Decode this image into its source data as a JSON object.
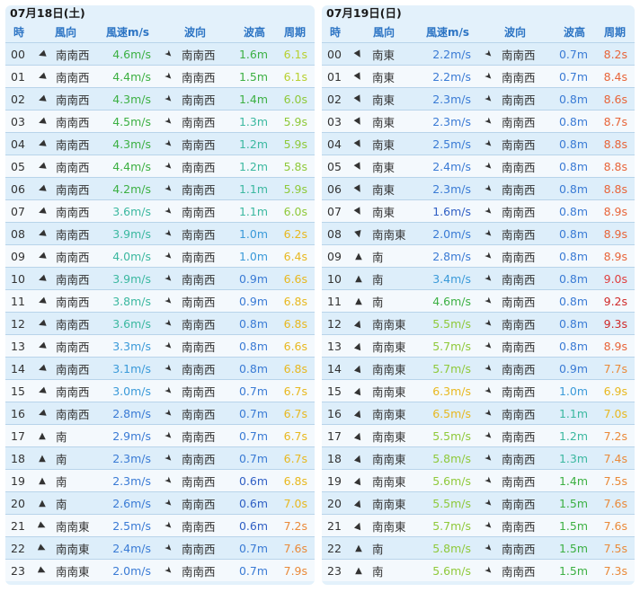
{
  "headers": {
    "hour": "時",
    "wind_dir": "風向",
    "wind_speed": "風速m/s",
    "wave_dir": "波向",
    "wave_height": "波高",
    "period": "周期"
  },
  "days": [
    {
      "date": "07月18日(土)",
      "rows": [
        {
          "h": "00",
          "d": "南南西",
          "a": 250,
          "s": "4.6m/s",
          "sc": "#3cb043",
          "wd": "南南西",
          "wh": "1.6m",
          "hc": "#3cb043",
          "p": "6.1s",
          "pc": "#b8d030"
        },
        {
          "h": "01",
          "d": "南南西",
          "a": 250,
          "s": "4.4m/s",
          "sc": "#3cb043",
          "wd": "南南西",
          "wh": "1.5m",
          "hc": "#3cb043",
          "p": "6.1s",
          "pc": "#b8d030"
        },
        {
          "h": "02",
          "d": "南南西",
          "a": 250,
          "s": "4.3m/s",
          "sc": "#3cb043",
          "wd": "南南西",
          "wh": "1.4m",
          "hc": "#3cb043",
          "p": "6.0s",
          "pc": "#8fc93a"
        },
        {
          "h": "03",
          "d": "南南西",
          "a": 250,
          "s": "4.5m/s",
          "sc": "#3cb043",
          "wd": "南南西",
          "wh": "1.3m",
          "hc": "#3bb8a0",
          "p": "5.9s",
          "pc": "#8fc93a"
        },
        {
          "h": "04",
          "d": "南南西",
          "a": 250,
          "s": "4.3m/s",
          "sc": "#3cb043",
          "wd": "南南西",
          "wh": "1.2m",
          "hc": "#3bb8a0",
          "p": "5.9s",
          "pc": "#8fc93a"
        },
        {
          "h": "05",
          "d": "南南西",
          "a": 250,
          "s": "4.4m/s",
          "sc": "#3cb043",
          "wd": "南南西",
          "wh": "1.2m",
          "hc": "#3bb8a0",
          "p": "5.8s",
          "pc": "#8fc93a"
        },
        {
          "h": "06",
          "d": "南南西",
          "a": 250,
          "s": "4.2m/s",
          "sc": "#3cb043",
          "wd": "南南西",
          "wh": "1.1m",
          "hc": "#3bb8a0",
          "p": "5.9s",
          "pc": "#8fc93a"
        },
        {
          "h": "07",
          "d": "南南西",
          "a": 250,
          "s": "3.6m/s",
          "sc": "#3bb8a0",
          "wd": "南南西",
          "wh": "1.1m",
          "hc": "#3bb8a0",
          "p": "6.0s",
          "pc": "#8fc93a"
        },
        {
          "h": "08",
          "d": "南南西",
          "a": 250,
          "s": "3.9m/s",
          "sc": "#3bb8a0",
          "wd": "南南西",
          "wh": "1.0m",
          "hc": "#3a9ad9",
          "p": "6.2s",
          "pc": "#e8b820"
        },
        {
          "h": "09",
          "d": "南南西",
          "a": 250,
          "s": "4.0m/s",
          "sc": "#3bb8a0",
          "wd": "南南西",
          "wh": "1.0m",
          "hc": "#3a9ad9",
          "p": "6.4s",
          "pc": "#e8b820"
        },
        {
          "h": "10",
          "d": "南南西",
          "a": 250,
          "s": "3.9m/s",
          "sc": "#3bb8a0",
          "wd": "南南西",
          "wh": "0.9m",
          "hc": "#3a7bd5",
          "p": "6.6s",
          "pc": "#e8b820"
        },
        {
          "h": "11",
          "d": "南南西",
          "a": 250,
          "s": "3.8m/s",
          "sc": "#3bb8a0",
          "wd": "南南西",
          "wh": "0.9m",
          "hc": "#3a7bd5",
          "p": "6.8s",
          "pc": "#e8b820"
        },
        {
          "h": "12",
          "d": "南南西",
          "a": 250,
          "s": "3.6m/s",
          "sc": "#3bb8a0",
          "wd": "南南西",
          "wh": "0.8m",
          "hc": "#3a7bd5",
          "p": "6.8s",
          "pc": "#e8b820"
        },
        {
          "h": "13",
          "d": "南南西",
          "a": 250,
          "s": "3.3m/s",
          "sc": "#3a9ad9",
          "wd": "南南西",
          "wh": "0.8m",
          "hc": "#3a7bd5",
          "p": "6.6s",
          "pc": "#e8b820"
        },
        {
          "h": "14",
          "d": "南南西",
          "a": 250,
          "s": "3.1m/s",
          "sc": "#3a9ad9",
          "wd": "南南西",
          "wh": "0.8m",
          "hc": "#3a7bd5",
          "p": "6.8s",
          "pc": "#e8b820"
        },
        {
          "h": "15",
          "d": "南南西",
          "a": 250,
          "s": "3.0m/s",
          "sc": "#3a9ad9",
          "wd": "南南西",
          "wh": "0.7m",
          "hc": "#3a7bd5",
          "p": "6.7s",
          "pc": "#e8b820"
        },
        {
          "h": "16",
          "d": "南南西",
          "a": 250,
          "s": "2.8m/s",
          "sc": "#3a7bd5",
          "wd": "南南西",
          "wh": "0.7m",
          "hc": "#3a7bd5",
          "p": "6.7s",
          "pc": "#e8b820"
        },
        {
          "h": "17",
          "d": "南",
          "a": 0,
          "s": "2.9m/s",
          "sc": "#3a7bd5",
          "wd": "南南西",
          "wh": "0.7m",
          "hc": "#3a7bd5",
          "p": "6.7s",
          "pc": "#e8b820"
        },
        {
          "h": "18",
          "d": "南",
          "a": 0,
          "s": "2.3m/s",
          "sc": "#3a7bd5",
          "wd": "南南西",
          "wh": "0.7m",
          "hc": "#3a7bd5",
          "p": "6.7s",
          "pc": "#e8b820"
        },
        {
          "h": "19",
          "d": "南",
          "a": 0,
          "s": "2.3m/s",
          "sc": "#3a7bd5",
          "wd": "南南西",
          "wh": "0.6m",
          "hc": "#2f5fc4",
          "p": "6.8s",
          "pc": "#e8b820"
        },
        {
          "h": "20",
          "d": "南",
          "a": 0,
          "s": "2.6m/s",
          "sc": "#3a7bd5",
          "wd": "南南西",
          "wh": "0.6m",
          "hc": "#2f5fc4",
          "p": "7.0s",
          "pc": "#e8b820"
        },
        {
          "h": "21",
          "d": "南南東",
          "a": 115,
          "s": "2.5m/s",
          "sc": "#3a7bd5",
          "wd": "南南西",
          "wh": "0.6m",
          "hc": "#2f5fc4",
          "p": "7.2s",
          "pc": "#ea8a3a"
        },
        {
          "h": "22",
          "d": "南南東",
          "a": 115,
          "s": "2.4m/s",
          "sc": "#3a7bd5",
          "wd": "南南西",
          "wh": "0.7m",
          "hc": "#3a7bd5",
          "p": "7.6s",
          "pc": "#ea8a3a"
        },
        {
          "h": "23",
          "d": "南南東",
          "a": 115,
          "s": "2.0m/s",
          "sc": "#3a7bd5",
          "wd": "南南西",
          "wh": "0.7m",
          "hc": "#3a7bd5",
          "p": "7.9s",
          "pc": "#ea8a3a"
        }
      ]
    },
    {
      "date": "07月19日(日)",
      "rows": [
        {
          "h": "00",
          "d": "南東",
          "a": 150,
          "s": "2.2m/s",
          "sc": "#3a7bd5",
          "wd": "南南西",
          "wh": "0.7m",
          "hc": "#3a7bd5",
          "p": "8.2s",
          "pc": "#e8653a"
        },
        {
          "h": "01",
          "d": "南東",
          "a": 150,
          "s": "2.2m/s",
          "sc": "#3a7bd5",
          "wd": "南南西",
          "wh": "0.7m",
          "hc": "#3a7bd5",
          "p": "8.4s",
          "pc": "#e8653a"
        },
        {
          "h": "02",
          "d": "南東",
          "a": 150,
          "s": "2.3m/s",
          "sc": "#3a7bd5",
          "wd": "南南西",
          "wh": "0.8m",
          "hc": "#3a7bd5",
          "p": "8.6s",
          "pc": "#e8653a"
        },
        {
          "h": "03",
          "d": "南東",
          "a": 150,
          "s": "2.3m/s",
          "sc": "#3a7bd5",
          "wd": "南南西",
          "wh": "0.8m",
          "hc": "#3a7bd5",
          "p": "8.7s",
          "pc": "#e8653a"
        },
        {
          "h": "04",
          "d": "南東",
          "a": 150,
          "s": "2.5m/s",
          "sc": "#3a7bd5",
          "wd": "南南西",
          "wh": "0.8m",
          "hc": "#3a7bd5",
          "p": "8.8s",
          "pc": "#e8653a"
        },
        {
          "h": "05",
          "d": "南東",
          "a": 150,
          "s": "2.4m/s",
          "sc": "#3a7bd5",
          "wd": "南南西",
          "wh": "0.8m",
          "hc": "#3a7bd5",
          "p": "8.8s",
          "pc": "#e8653a"
        },
        {
          "h": "06",
          "d": "南東",
          "a": 150,
          "s": "2.3m/s",
          "sc": "#3a7bd5",
          "wd": "南南西",
          "wh": "0.8m",
          "hc": "#3a7bd5",
          "p": "8.8s",
          "pc": "#e8653a"
        },
        {
          "h": "07",
          "d": "南東",
          "a": 150,
          "s": "1.6m/s",
          "sc": "#2f5fc4",
          "wd": "南南西",
          "wh": "0.8m",
          "hc": "#3a7bd5",
          "p": "8.9s",
          "pc": "#e8653a"
        },
        {
          "h": "08",
          "d": "南南東",
          "a": 165,
          "s": "2.0m/s",
          "sc": "#3a7bd5",
          "wd": "南南西",
          "wh": "0.8m",
          "hc": "#3a7bd5",
          "p": "8.9s",
          "pc": "#e8653a"
        },
        {
          "h": "09",
          "d": "南",
          "a": 0,
          "s": "2.8m/s",
          "sc": "#3a7bd5",
          "wd": "南南西",
          "wh": "0.8m",
          "hc": "#3a7bd5",
          "p": "8.9s",
          "pc": "#e8653a"
        },
        {
          "h": "10",
          "d": "南",
          "a": 0,
          "s": "3.4m/s",
          "sc": "#3a9ad9",
          "wd": "南南西",
          "wh": "0.8m",
          "hc": "#3a7bd5",
          "p": "9.0s",
          "pc": "#e04040"
        },
        {
          "h": "11",
          "d": "南",
          "a": 0,
          "s": "4.6m/s",
          "sc": "#3cb043",
          "wd": "南南西",
          "wh": "0.8m",
          "hc": "#3a7bd5",
          "p": "9.2s",
          "pc": "#d02a2a"
        },
        {
          "h": "12",
          "d": "南南東",
          "a": 20,
          "s": "5.5m/s",
          "sc": "#8fc93a",
          "wd": "南南西",
          "wh": "0.8m",
          "hc": "#3a7bd5",
          "p": "9.3s",
          "pc": "#d02a2a"
        },
        {
          "h": "13",
          "d": "南南東",
          "a": 20,
          "s": "5.7m/s",
          "sc": "#8fc93a",
          "wd": "南南西",
          "wh": "0.8m",
          "hc": "#3a7bd5",
          "p": "8.9s",
          "pc": "#e8653a"
        },
        {
          "h": "14",
          "d": "南南東",
          "a": 20,
          "s": "5.7m/s",
          "sc": "#8fc93a",
          "wd": "南南西",
          "wh": "0.9m",
          "hc": "#3a7bd5",
          "p": "7.7s",
          "pc": "#ea8a3a"
        },
        {
          "h": "15",
          "d": "南南東",
          "a": 20,
          "s": "6.3m/s",
          "sc": "#e8b820",
          "wd": "南南西",
          "wh": "1.0m",
          "hc": "#3a9ad9",
          "p": "6.9s",
          "pc": "#e8b820"
        },
        {
          "h": "16",
          "d": "南南東",
          "a": 20,
          "s": "6.5m/s",
          "sc": "#e8b820",
          "wd": "南南西",
          "wh": "1.1m",
          "hc": "#3bb8a0",
          "p": "7.0s",
          "pc": "#e8b820"
        },
        {
          "h": "17",
          "d": "南南東",
          "a": 20,
          "s": "5.5m/s",
          "sc": "#8fc93a",
          "wd": "南南西",
          "wh": "1.2m",
          "hc": "#3bb8a0",
          "p": "7.2s",
          "pc": "#ea8a3a"
        },
        {
          "h": "18",
          "d": "南南東",
          "a": 20,
          "s": "5.8m/s",
          "sc": "#8fc93a",
          "wd": "南南西",
          "wh": "1.3m",
          "hc": "#3bb8a0",
          "p": "7.4s",
          "pc": "#ea8a3a"
        },
        {
          "h": "19",
          "d": "南南東",
          "a": 20,
          "s": "5.6m/s",
          "sc": "#8fc93a",
          "wd": "南南西",
          "wh": "1.4m",
          "hc": "#3cb043",
          "p": "7.5s",
          "pc": "#ea8a3a"
        },
        {
          "h": "20",
          "d": "南南東",
          "a": 20,
          "s": "5.5m/s",
          "sc": "#8fc93a",
          "wd": "南南西",
          "wh": "1.5m",
          "hc": "#3cb043",
          "p": "7.6s",
          "pc": "#ea8a3a"
        },
        {
          "h": "21",
          "d": "南南東",
          "a": 20,
          "s": "5.7m/s",
          "sc": "#8fc93a",
          "wd": "南南西",
          "wh": "1.5m",
          "hc": "#3cb043",
          "p": "7.6s",
          "pc": "#ea8a3a"
        },
        {
          "h": "22",
          "d": "南",
          "a": 0,
          "s": "5.8m/s",
          "sc": "#8fc93a",
          "wd": "南南西",
          "wh": "1.5m",
          "hc": "#3cb043",
          "p": "7.5s",
          "pc": "#ea8a3a"
        },
        {
          "h": "23",
          "d": "南",
          "a": 0,
          "s": "5.6m/s",
          "sc": "#8fc93a",
          "wd": "南南西",
          "wh": "1.5m",
          "hc": "#3cb043",
          "p": "7.3s",
          "pc": "#ea8a3a"
        }
      ]
    }
  ]
}
